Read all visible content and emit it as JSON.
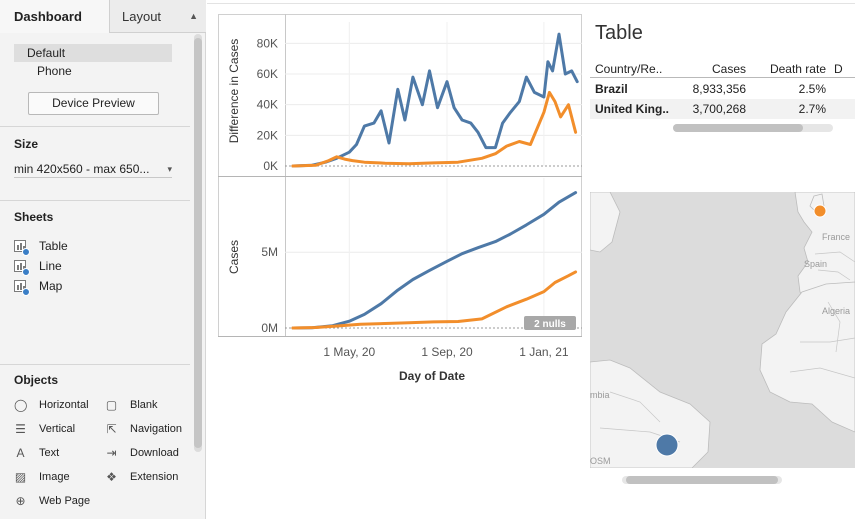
{
  "left_pane": {
    "tabs": {
      "dashboard": "Dashboard",
      "layout": "Layout",
      "layout_icon": "updown-arrows-icon"
    },
    "devices": {
      "default": "Default",
      "phone": "Phone"
    },
    "device_preview_button": "Device Preview",
    "size": {
      "title": "Size",
      "value": "min 420x560 - max 650...",
      "caret": "▾"
    },
    "sheets": {
      "title": "Sheets",
      "items": [
        {
          "label": "Table",
          "icon": "sheet-icon"
        },
        {
          "label": "Line",
          "icon": "sheet-icon"
        },
        {
          "label": "Map",
          "icon": "sheet-icon"
        }
      ]
    },
    "objects": {
      "title": "Objects",
      "items": [
        {
          "label": "Horizontal",
          "icon": "horizontal-container-icon",
          "glyph": "◯"
        },
        {
          "label": "Blank",
          "icon": "blank-icon",
          "glyph": "▢"
        },
        {
          "label": "Vertical",
          "icon": "vertical-container-icon",
          "glyph": "☰"
        },
        {
          "label": "Navigation",
          "icon": "navigation-icon",
          "glyph": "⇱"
        },
        {
          "label": "Text",
          "icon": "text-icon",
          "glyph": "A"
        },
        {
          "label": "Download",
          "icon": "download-icon",
          "glyph": "⇥"
        },
        {
          "label": "Image",
          "icon": "image-icon",
          "glyph": "▨"
        },
        {
          "label": "Extension",
          "icon": "extension-icon",
          "glyph": "❖"
        },
        {
          "label": "Web Page",
          "icon": "globe-icon",
          "glyph": "⊕"
        }
      ]
    }
  },
  "colors": {
    "blue": "#4e79a7",
    "orange": "#f28e2b"
  },
  "line_view": {
    "nulls_badge": "2 nulls"
  },
  "chart_data": [
    {
      "type": "line",
      "ylabel": "Difference in Cases",
      "y_ticks": [
        "0K",
        "20K",
        "40K",
        "60K",
        "80K"
      ],
      "ylim": [
        0,
        90000
      ],
      "x_ticks": [
        "1 May, 20",
        "1 Sep, 20",
        "1 Jan, 21"
      ],
      "xlabel": "Day of Date",
      "xlim": [
        "2020-02-10",
        "2021-02-18"
      ],
      "series": [
        {
          "color": "#4e79a7",
          "x": [
            "2020-02-20",
            "2020-03-15",
            "2020-04-01",
            "2020-04-15",
            "2020-05-01",
            "2020-05-10",
            "2020-05-20",
            "2020-06-01",
            "2020-06-10",
            "2020-06-20",
            "2020-07-01",
            "2020-07-10",
            "2020-07-20",
            "2020-08-01",
            "2020-08-10",
            "2020-08-20",
            "2020-09-01",
            "2020-09-10",
            "2020-09-20",
            "2020-10-01",
            "2020-10-10",
            "2020-10-20",
            "2020-11-01",
            "2020-11-10",
            "2020-11-20",
            "2020-12-01",
            "2020-12-10",
            "2020-12-20",
            "2021-01-01",
            "2021-01-06",
            "2021-01-12",
            "2021-01-20",
            "2021-01-28",
            "2021-02-05",
            "2021-02-12"
          ],
          "y": [
            0,
            500,
            2500,
            5000,
            9000,
            14000,
            26000,
            28000,
            36000,
            15000,
            50000,
            30000,
            58000,
            40000,
            62000,
            38000,
            55000,
            38000,
            30000,
            28000,
            22000,
            12000,
            12000,
            28000,
            35000,
            42000,
            58000,
            48000,
            45000,
            68000,
            62000,
            86000,
            60000,
            62000,
            55000
          ]
        },
        {
          "color": "#f28e2b",
          "x": [
            "2020-02-20",
            "2020-03-20",
            "2020-04-05",
            "2020-04-15",
            "2020-04-25",
            "2020-05-05",
            "2020-05-20",
            "2020-06-15",
            "2020-07-15",
            "2020-08-15",
            "2020-09-15",
            "2020-10-15",
            "2020-11-01",
            "2020-11-15",
            "2020-12-01",
            "2020-12-15",
            "2021-01-01",
            "2021-01-08",
            "2021-01-15",
            "2021-01-22",
            "2021-02-01",
            "2021-02-10"
          ],
          "y": [
            0,
            500,
            3500,
            6000,
            4500,
            3500,
            2500,
            1800,
            1500,
            2000,
            2500,
            5000,
            8000,
            13000,
            16000,
            14000,
            35000,
            48000,
            42000,
            32000,
            40000,
            22000
          ]
        }
      ]
    },
    {
      "type": "line",
      "ylabel": "Cases",
      "y_ticks": [
        "0M",
        "5M"
      ],
      "ylim": [
        0,
        9500000
      ],
      "x_ticks": [
        "1 May, 20",
        "1 Sep, 20",
        "1 Jan, 21"
      ],
      "xlabel": "Day of Date",
      "xlim": [
        "2020-02-10",
        "2021-02-18"
      ],
      "series": [
        {
          "color": "#4e79a7",
          "x": [
            "2020-02-20",
            "2020-03-15",
            "2020-04-10",
            "2020-05-01",
            "2020-05-20",
            "2020-06-10",
            "2020-07-01",
            "2020-07-20",
            "2020-08-10",
            "2020-09-01",
            "2020-09-20",
            "2020-10-10",
            "2020-11-01",
            "2020-11-20",
            "2020-12-10",
            "2021-01-01",
            "2021-01-20",
            "2021-02-10"
          ],
          "y": [
            0,
            10000,
            150000,
            450000,
            900000,
            1600000,
            2500000,
            3200000,
            3800000,
            4400000,
            4900000,
            5300000,
            5700000,
            6200000,
            6800000,
            7500000,
            8300000,
            8933356
          ]
        },
        {
          "color": "#f28e2b",
          "x": [
            "2020-02-20",
            "2020-03-20",
            "2020-04-20",
            "2020-05-15",
            "2020-06-15",
            "2020-07-15",
            "2020-08-15",
            "2020-09-15",
            "2020-10-15",
            "2020-11-15",
            "2020-12-10",
            "2021-01-01",
            "2021-01-15",
            "2021-02-01",
            "2021-02-10"
          ],
          "y": [
            0,
            30000,
            150000,
            250000,
            300000,
            350000,
            400000,
            430000,
            600000,
            1400000,
            1900000,
            2400000,
            3000000,
            3450000,
            3700268
          ]
        }
      ]
    }
  ],
  "table_view": {
    "title": "Table",
    "columns": [
      "Country/Re..",
      "Cases",
      "Death rate",
      "D"
    ],
    "rows": [
      [
        "Brazil",
        "8,933,356",
        "2.5%"
      ],
      [
        "United King..",
        "3,700,268",
        "2.7%"
      ]
    ]
  },
  "map_view": {
    "labels": [
      "Spain",
      "France",
      "Algeria",
      "mbia",
      "OSM"
    ],
    "points": [
      {
        "name": "United Kingdom",
        "color": "#f28e2b",
        "size": "small"
      },
      {
        "name": "Brazil",
        "color": "#4e79a7",
        "size": "large"
      }
    ]
  }
}
